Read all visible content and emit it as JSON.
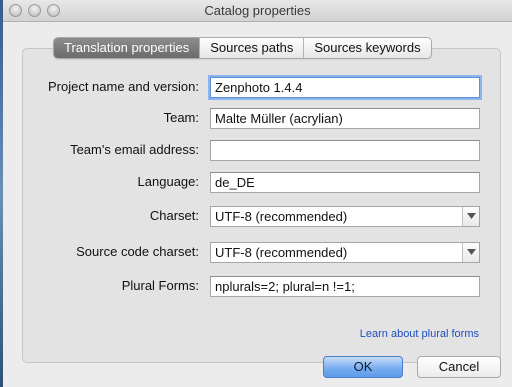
{
  "window": {
    "title": "Catalog properties"
  },
  "tabs": [
    {
      "label": "Translation properties",
      "active": true
    },
    {
      "label": "Sources paths",
      "active": false
    },
    {
      "label": "Sources keywords",
      "active": false
    }
  ],
  "form": {
    "project_name": {
      "label": "Project name and version:",
      "value": "Zenphoto 1.4.4"
    },
    "team": {
      "label": "Team:",
      "value": "Malte Müller (acrylian)"
    },
    "team_email": {
      "label": "Team's email address:",
      "value": ""
    },
    "language": {
      "label": "Language:",
      "value": "de_DE"
    },
    "charset": {
      "label": "Charset:",
      "value": "UTF-8 (recommended)"
    },
    "source_charset": {
      "label": "Source code charset:",
      "value": "UTF-8 (recommended)"
    },
    "plural_forms": {
      "label": "Plural Forms:",
      "value": "nplurals=2; plural=n !=1;"
    }
  },
  "link": {
    "plural_help": "Learn about plural forms"
  },
  "buttons": {
    "ok": "OK",
    "cancel": "Cancel"
  },
  "colors": {
    "accent": "#5c9ae8",
    "link": "#1f4fbf",
    "focus_ring": "#8cb5ee"
  },
  "icons": {
    "close": "close-circle-icon",
    "minimize": "minimize-circle-icon",
    "zoom": "zoom-circle-icon",
    "dropdown": "chevron-down-icon"
  }
}
